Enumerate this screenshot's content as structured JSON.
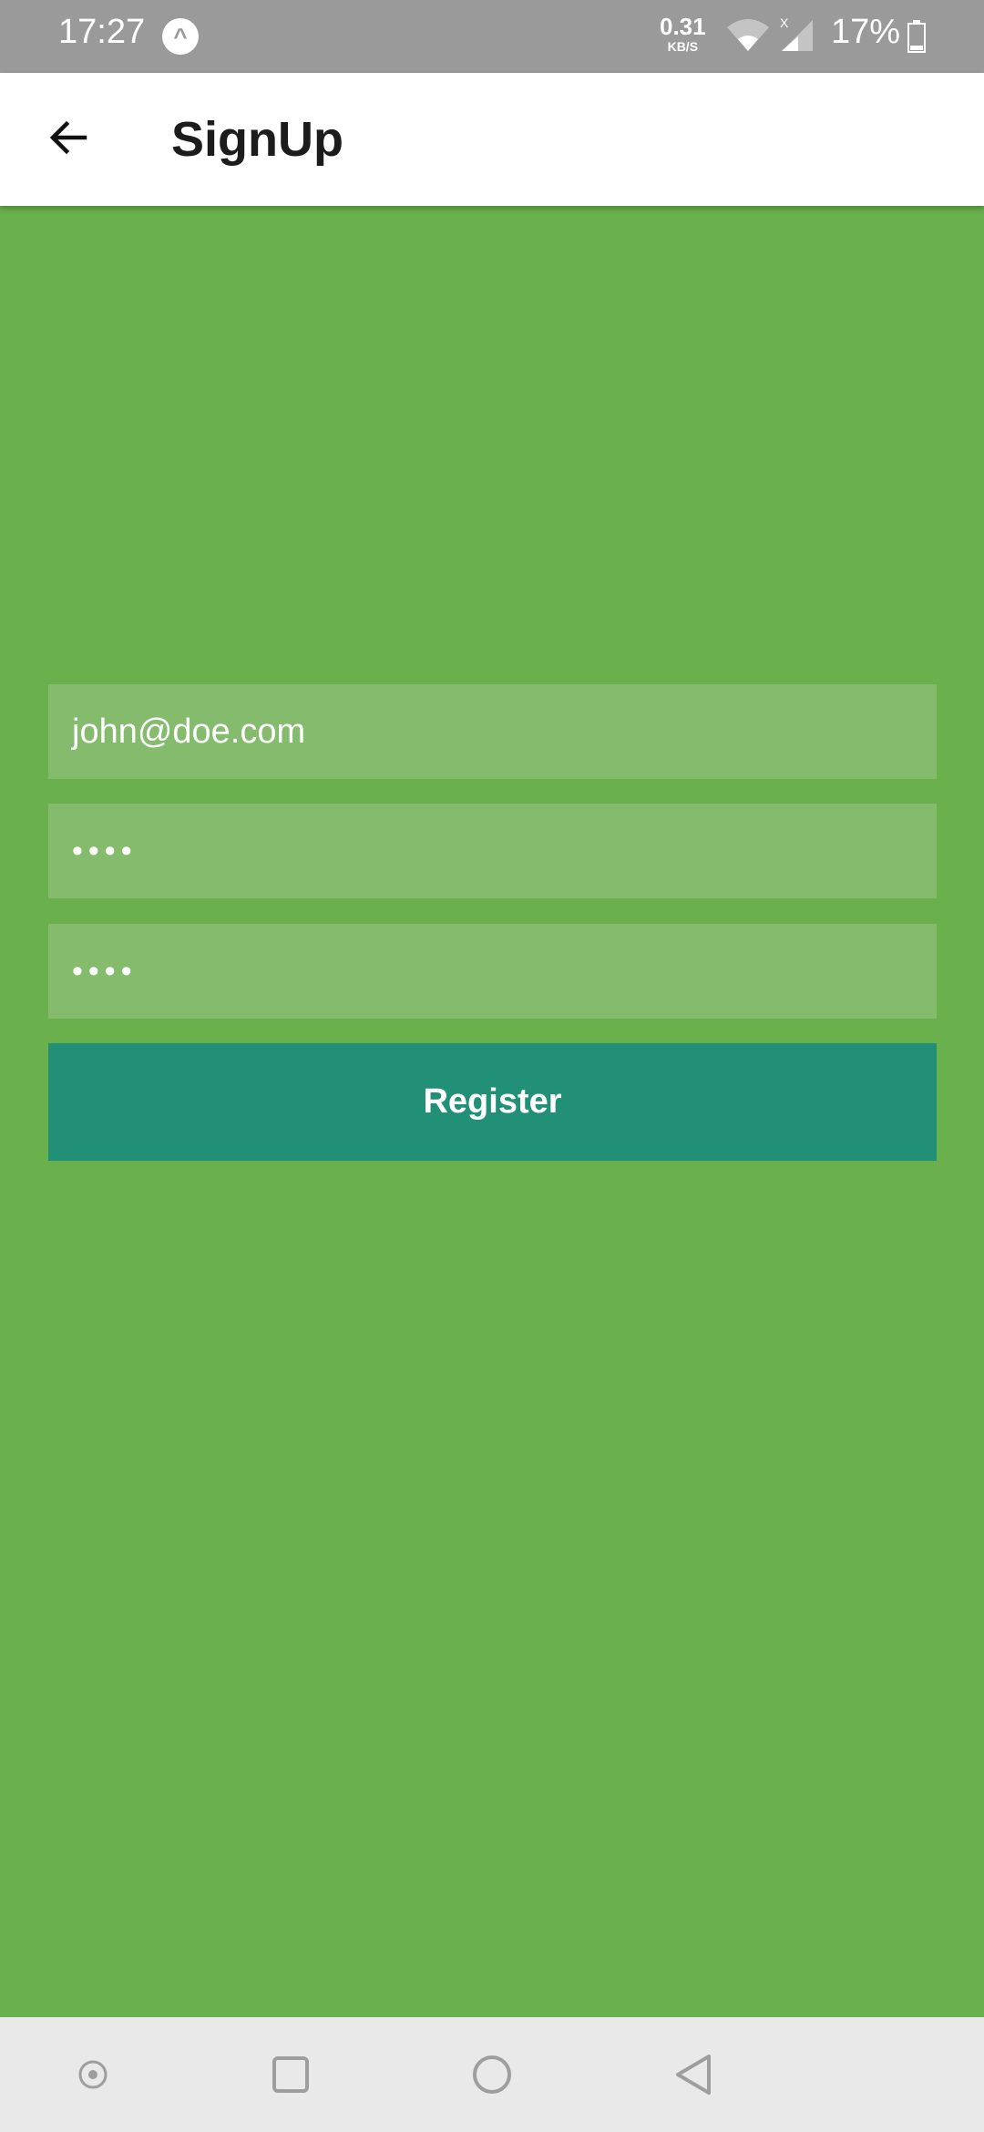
{
  "status_bar": {
    "time": "17:27",
    "app_icon_glyph": "^",
    "net_speed_value": "0.31",
    "net_speed_unit": "KB/S",
    "signal_badge": "X",
    "battery_percent": "17%",
    "icons": [
      "app-notification-icon",
      "wifi-icon",
      "signal-icon",
      "battery-icon"
    ]
  },
  "app_bar": {
    "back_icon": "arrow-left-icon",
    "title": "SignUp"
  },
  "form": {
    "email_value": "john@doe.com",
    "password_value": "••••",
    "confirm_password_value": "••••",
    "register_label": "Register"
  },
  "nav_bar": {
    "icons": [
      "assistant-icon",
      "recents-icon",
      "home-icon",
      "back-icon"
    ]
  },
  "colors": {
    "background": "#6ab04c",
    "field": "#84bb6c",
    "button": "#229076",
    "status_bar": "#9a9a9a",
    "app_bar": "#ffffff"
  }
}
